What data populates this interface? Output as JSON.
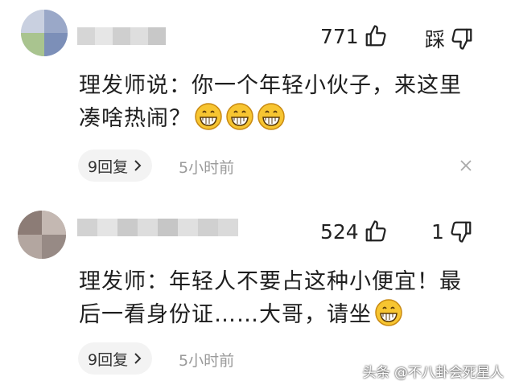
{
  "comments": [
    {
      "likes": "771",
      "dislike_label": "踩",
      "lines": [
        "理发师说：你一个年轻小伙子，来这里",
        "凑啥热闹？"
      ],
      "emoji_count": 3,
      "replies": "9回复",
      "time": "5小时前"
    },
    {
      "likes": "524",
      "dislikes": "1",
      "lines": [
        "理发师：年轻人不要占这种小便宜！最",
        "后一看身份证……大哥，请坐"
      ],
      "emoji_count": 1,
      "replies": "9回复",
      "time": "5小时前"
    }
  ],
  "watermark": "头条 @不八卦会死星人",
  "icons": {
    "like": "thumbs-up-icon",
    "dislike": "thumbs-down-icon",
    "emoji": "grinning-face-icon",
    "reply_chevron": "chevron-right-icon",
    "close": "close-icon"
  },
  "colors": {
    "emoji_fill": "#f7c531",
    "reply_bg": "#f3f3f3",
    "time_text": "#9a9a9a"
  }
}
